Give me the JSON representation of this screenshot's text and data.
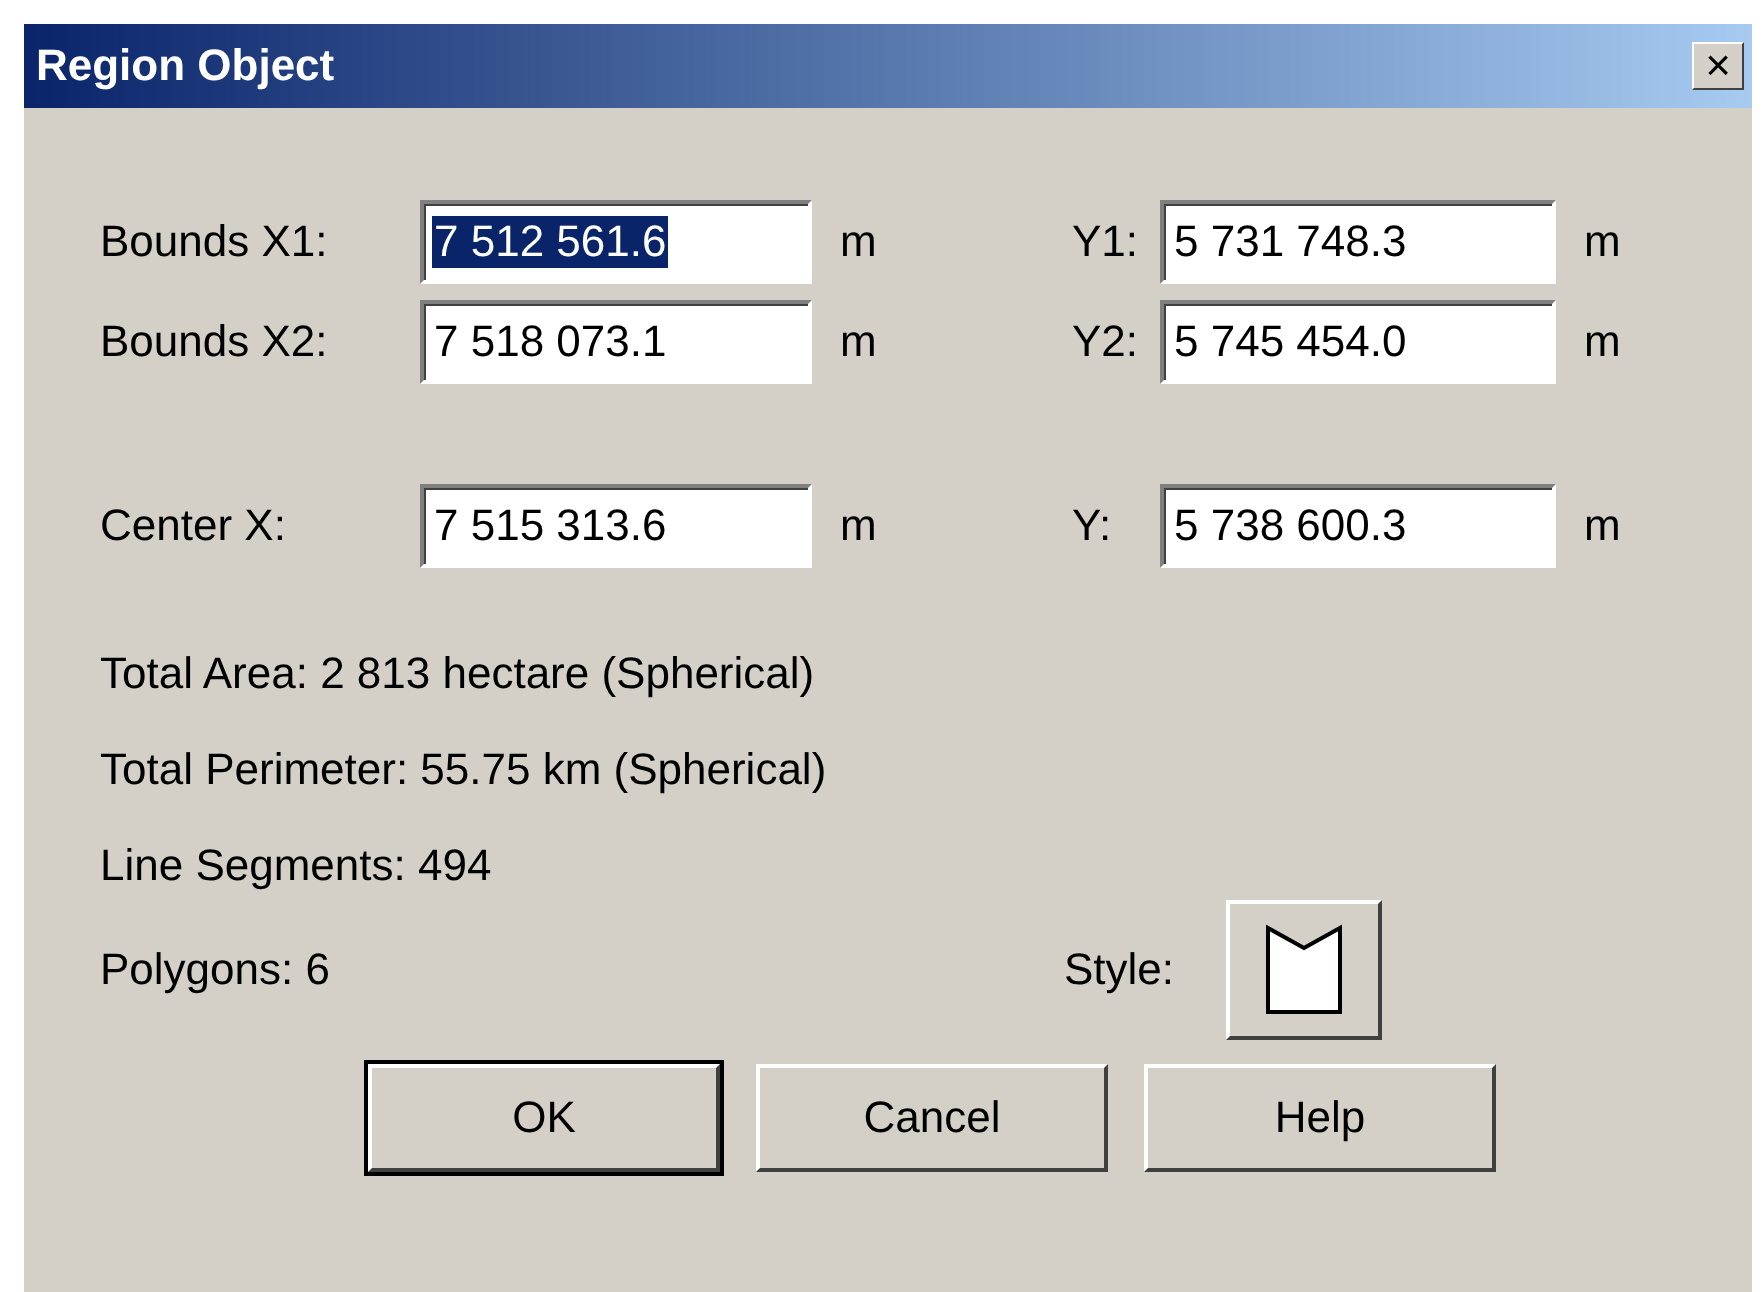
{
  "window": {
    "title": "Region Object",
    "close": "×"
  },
  "coordinate_rows": [
    {
      "fields": [
        {
          "label": "Bounds X1:",
          "value": "7 512 561.6",
          "unit": "m",
          "selected": true
        },
        {
          "label": "Y1:",
          "value": "5 731 748.3",
          "unit": "m",
          "selected": false
        }
      ]
    },
    {
      "fields": [
        {
          "label": "Bounds X2:",
          "value": "7 518 073.1",
          "unit": "m",
          "selected": false
        },
        {
          "label": "Y2:",
          "value": "5 745 454.0",
          "unit": "m",
          "selected": false
        }
      ]
    },
    {
      "fields": [
        {
          "label": "Center X:",
          "value": "7 515 313.6",
          "unit": "m",
          "selected": false
        },
        {
          "label": "Y:",
          "value": "5 738 600.3",
          "unit": "m",
          "selected": false
        }
      ]
    }
  ],
  "stats": [
    "Total Area:  2 813 hectare (Spherical)",
    "Total Perimeter:  55.75 km (Spherical)",
    "Line Segments:  494",
    "Polygons:  6"
  ],
  "style": {
    "label": "Style:"
  },
  "buttons": [
    {
      "label": "OK",
      "default": true
    },
    {
      "label": "Cancel",
      "default": false
    },
    {
      "label": "Help",
      "default": false
    }
  ]
}
